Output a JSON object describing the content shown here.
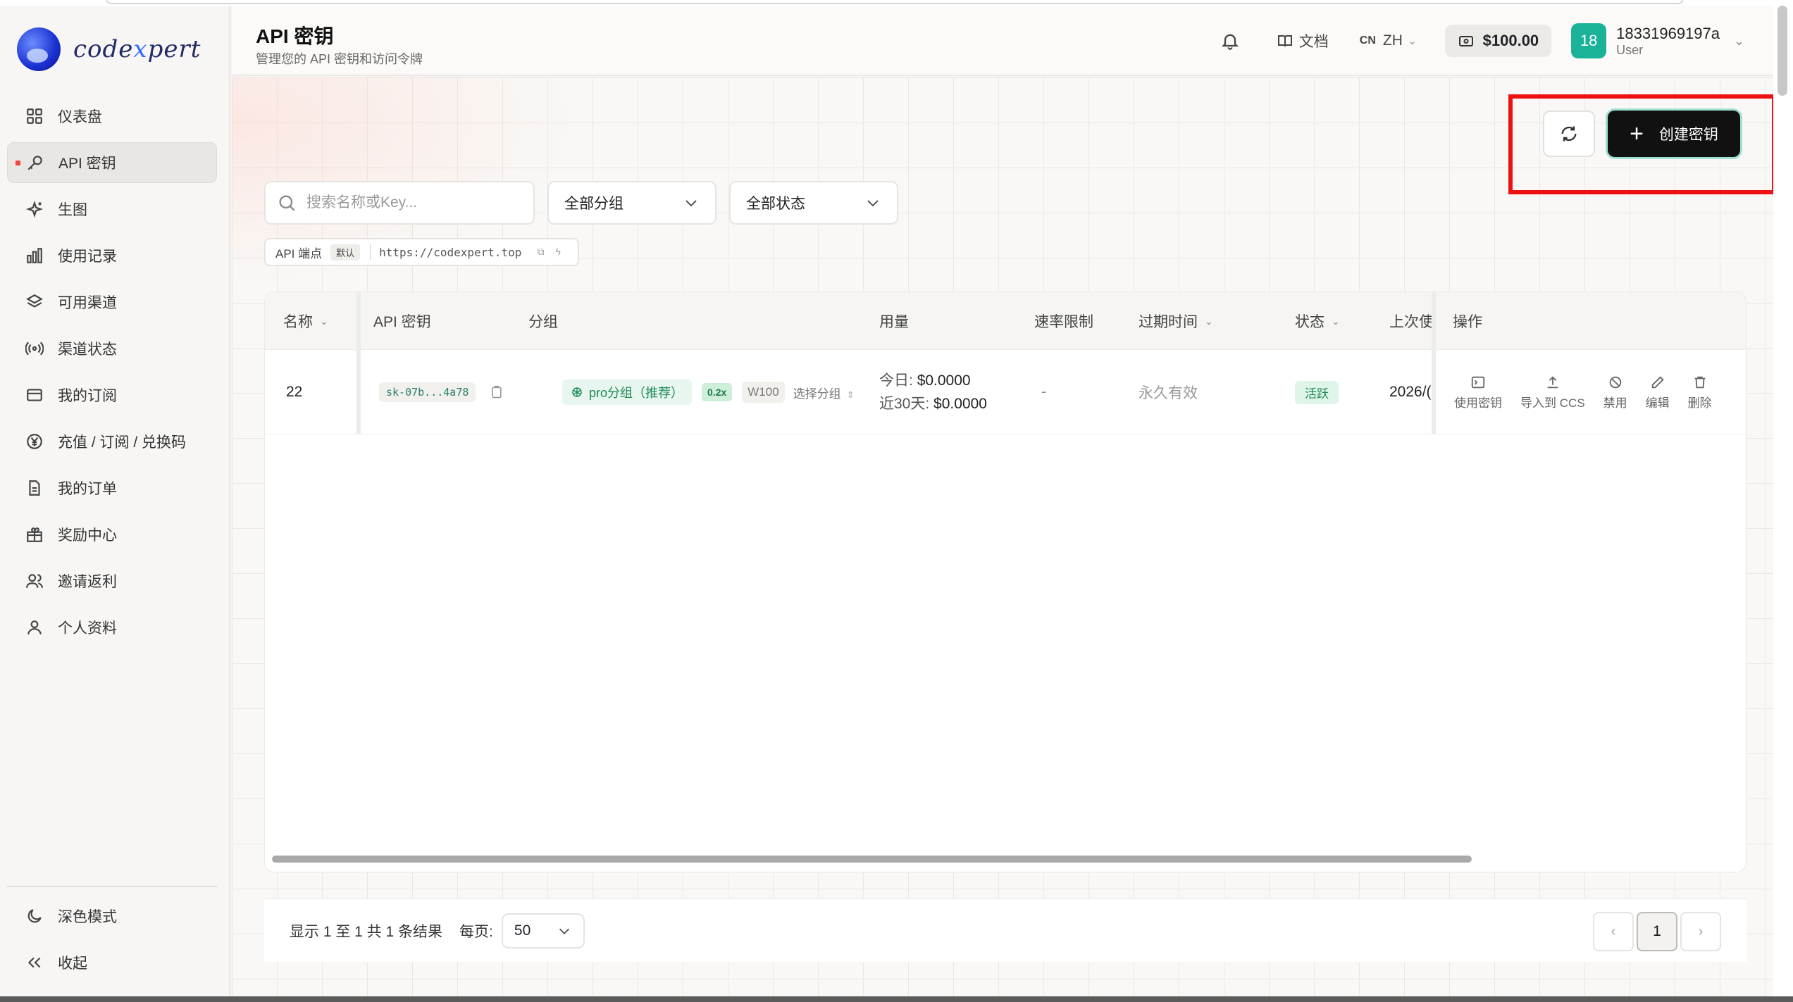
{
  "brand": {
    "name_a": "code",
    "name_x": "x",
    "name_b": "pert"
  },
  "sidebar": {
    "items": [
      {
        "label": "仪表盘",
        "icon": "dashboard-icon"
      },
      {
        "label": "API 密钥",
        "icon": "key-icon",
        "active": true
      },
      {
        "label": "生图",
        "icon": "sparkles-icon"
      },
      {
        "label": "使用记录",
        "icon": "bar-chart-icon"
      },
      {
        "label": "可用渠道",
        "icon": "layers-icon"
      },
      {
        "label": "渠道状态",
        "icon": "broadcast-icon"
      },
      {
        "label": "我的订阅",
        "icon": "card-icon"
      },
      {
        "label": "充值 / 订阅 / 兑换码",
        "icon": "yen-icon"
      },
      {
        "label": "我的订单",
        "icon": "file-icon"
      },
      {
        "label": "奖励中心",
        "icon": "gift-icon"
      },
      {
        "label": "邀请返利",
        "icon": "users-icon"
      },
      {
        "label": "个人资料",
        "icon": "user-icon"
      }
    ],
    "dark_mode": "深色模式",
    "collapse": "收起"
  },
  "header": {
    "title": "API 密钥",
    "subtitle": "管理您的 API 密钥和访问令牌",
    "docs": "文档",
    "lang_code": "CN",
    "lang": "ZH",
    "balance": "$100.00",
    "avatar": "18",
    "username": "18331969197a",
    "role": "User"
  },
  "toolbar": {
    "create": "创建密钥"
  },
  "filters": {
    "search_placeholder": "搜索名称或Key...",
    "group": "全部分组",
    "status": "全部状态"
  },
  "endpoint": {
    "label": "API 端点",
    "tag": "默认",
    "url": "https://codexpert.top"
  },
  "table": {
    "headers": {
      "name": "名称",
      "key": "API 密钥",
      "group": "分组",
      "usage": "用量",
      "rate": "速率限制",
      "expire": "过期时间",
      "status": "状态",
      "last": "上次使",
      "actions": "操作"
    },
    "rows": [
      {
        "name": "22",
        "key": "sk-07b...4a78",
        "group": "pro分组（推荐）",
        "multiplier": "0.2x",
        "wtag": "W100",
        "select_group": "选择分组",
        "usage_today_label": "今日:",
        "usage_today": "$0.0000",
        "usage_30_label": "近30天:",
        "usage_30": "$0.0000",
        "rate": "-",
        "expire": "永久有效",
        "status": "活跃",
        "last": "2026/("
      }
    ],
    "actions": [
      "使用密钥",
      "导入到 CCS",
      "禁用",
      "编辑",
      "删除"
    ]
  },
  "pager": {
    "info": "显示 1 至 1 共 1 条结果",
    "per_label": "每页:",
    "per_value": "50",
    "current": "1"
  }
}
